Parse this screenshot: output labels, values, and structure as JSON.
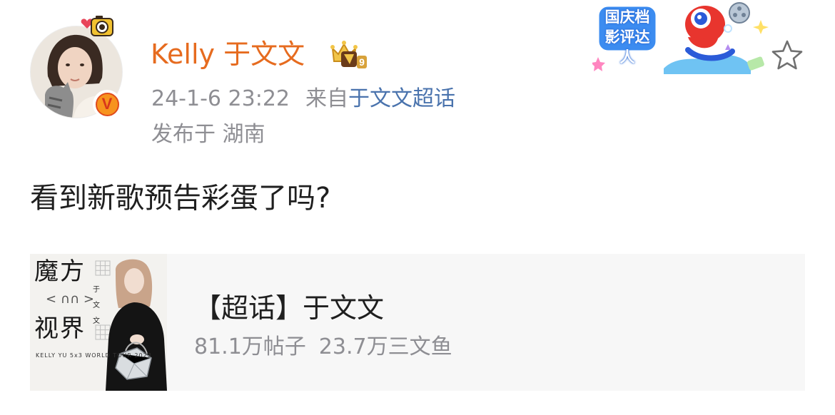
{
  "post": {
    "author": {
      "name": "Kelly 于文文",
      "avatar_icon": "user-avatar",
      "verified_icon": "verified-v-badge",
      "verified_letter": "V",
      "member_icon": "vip-crown-icon",
      "member_level": "9"
    },
    "timestamp": "24-1-6 23:22",
    "source_prefix": "来自",
    "source_name": "于文文超话",
    "location": "发布于 湖南",
    "text": "看到新歌预告彩蛋了吗?",
    "sticker": {
      "line1": "国庆档",
      "line2": "影评达人"
    }
  },
  "card": {
    "title": "【超话】于文文",
    "posts_count": "81.1万帖子",
    "fans_count": "23.7万三文鱼",
    "thumbnail": {
      "title_line1": "魔方",
      "title_line2": "视界",
      "side_text": "于文文",
      "brand": "KELLY YU",
      "tour": "KELLY YU 5x3 WORLD TOUR 2023"
    }
  },
  "colors": {
    "username": "#e66b1f",
    "link": "#4a73ad",
    "meta": "#8e8e93",
    "card_bg": "#f7f7f7",
    "text": "#1f1f1f"
  }
}
